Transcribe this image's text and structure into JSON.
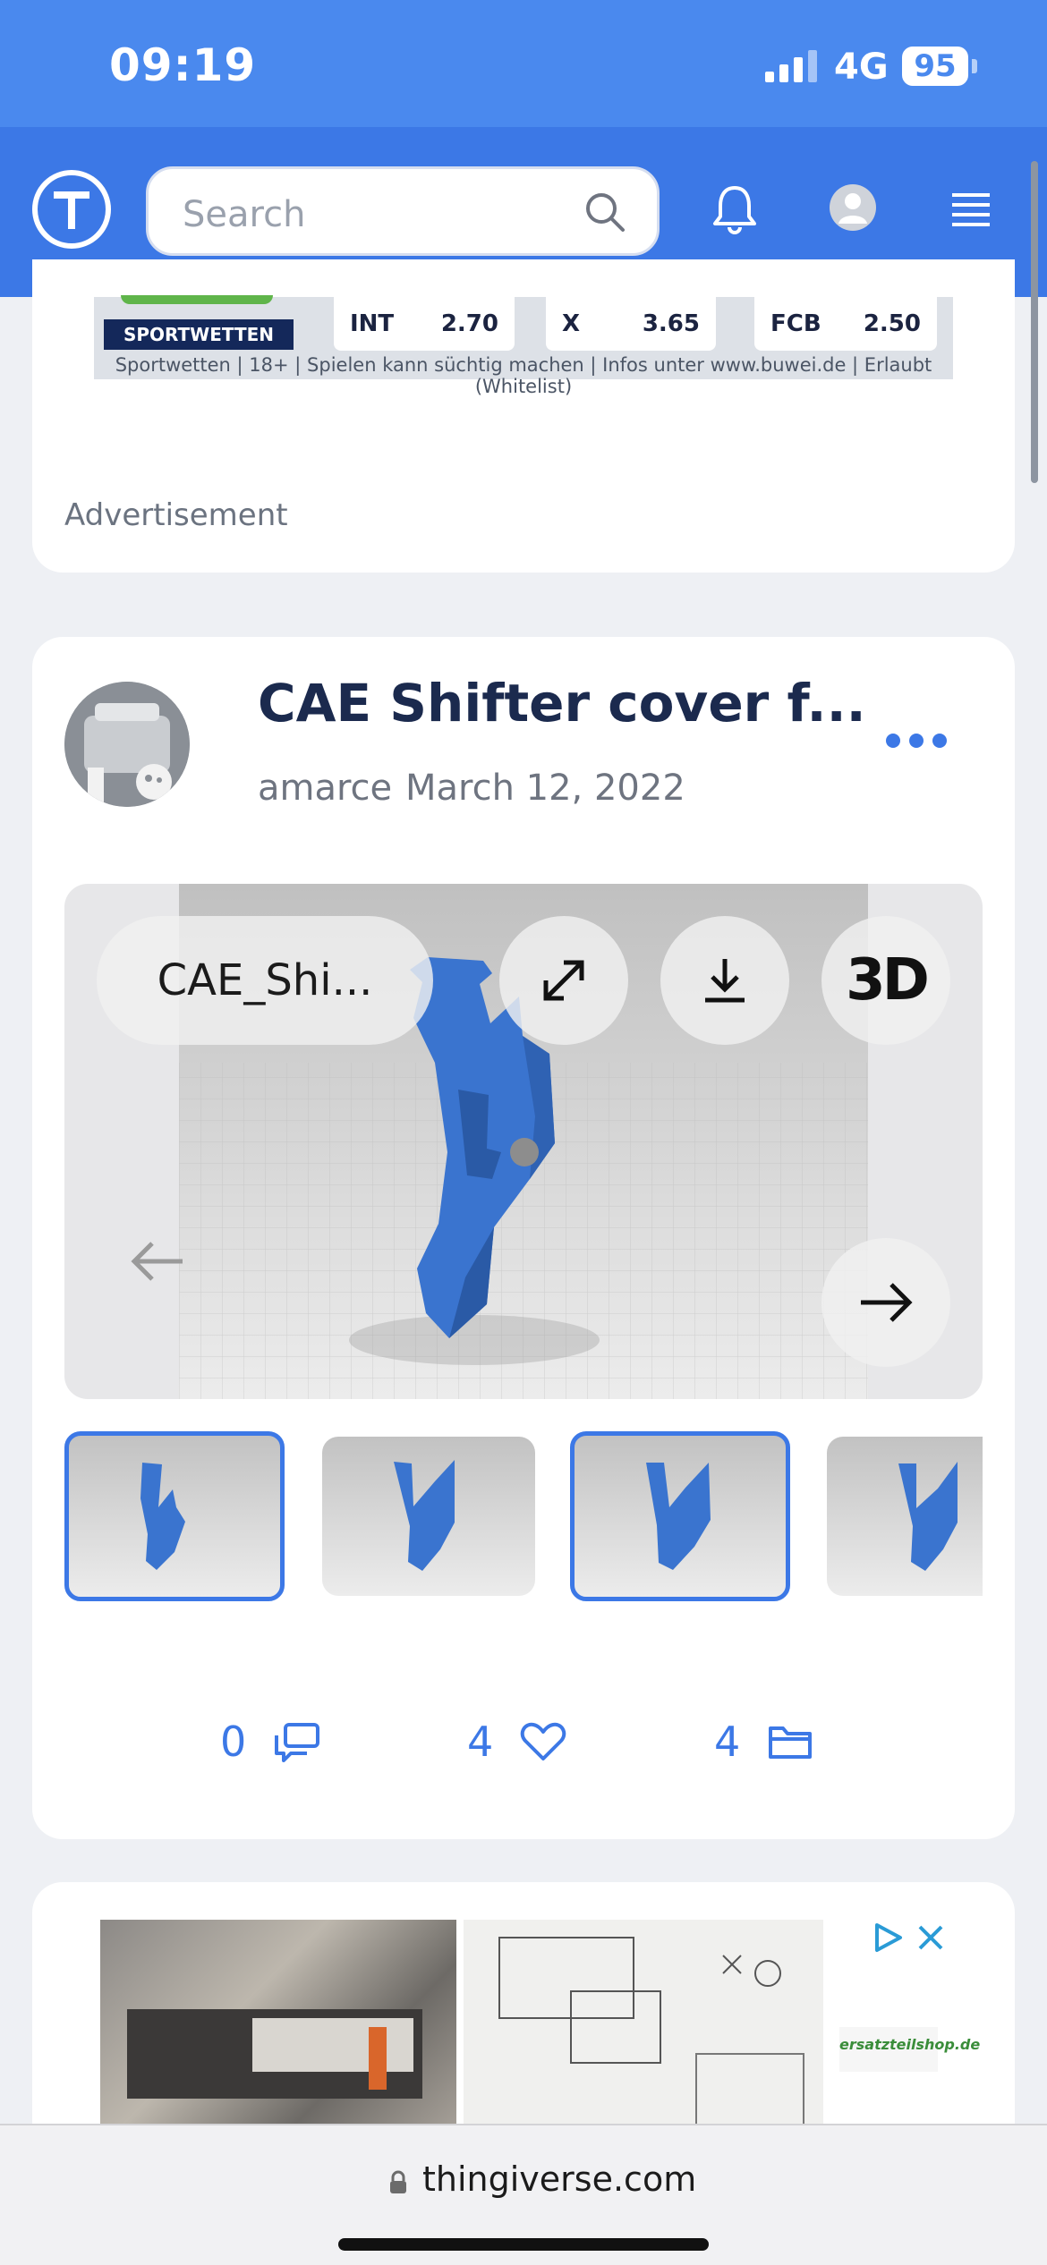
{
  "status_bar": {
    "time": "09:19",
    "network": "4G",
    "battery": "95"
  },
  "nav": {
    "search_placeholder": "Search"
  },
  "top_ad": {
    "sport_label": "SPORTWETTEN",
    "odds": [
      {
        "team": "INT",
        "value": "2.70"
      },
      {
        "team": "X",
        "value": "3.65"
      },
      {
        "team": "FCB",
        "value": "2.50"
      }
    ],
    "disclaimer": "Sportwetten | 18+ | Spielen kann süchtig machen | Infos unter www.buwei.de | Erlaubt (Whitelist)",
    "label": "Advertisement"
  },
  "thing": {
    "title": "CAE Shifter cover f...",
    "author": "amarce",
    "date": "March 12, 2022",
    "file_name": "CAE_Shi...",
    "viewer_3d_label": "3D",
    "stats": {
      "comments": "0",
      "likes": "4",
      "collections": "4"
    }
  },
  "bottom_ad": {
    "brand": "ersatzteilshop.de"
  },
  "browser": {
    "url": "thingiverse.com"
  },
  "colors": {
    "brand_blue": "#3c78e6",
    "status_blue": "#4a89ee",
    "model_blue": "#3a74cf"
  }
}
